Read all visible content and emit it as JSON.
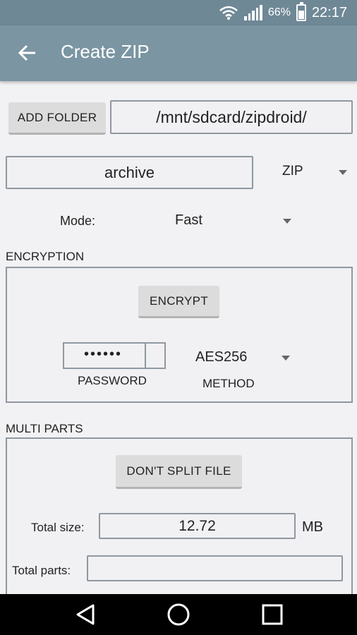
{
  "status_bar": {
    "battery_percent": "66%",
    "time": "22:17",
    "icons": [
      "wifi-icon",
      "signal-icon",
      "battery-icon"
    ]
  },
  "app_bar": {
    "title": "Create ZIP",
    "back_icon": "arrow-back-icon"
  },
  "destination": {
    "add_folder_label": "ADD FOLDER",
    "path": "/mnt/sdcard/zipdroid/"
  },
  "archive": {
    "name": "archive",
    "format": "ZIP"
  },
  "mode": {
    "label": "Mode:",
    "value": "Fast"
  },
  "encryption": {
    "section_title": "ENCRYPTION",
    "encrypt_label": "ENCRYPT",
    "password_mask": "••••••",
    "password_label": "PASSWORD",
    "method_value": "AES256",
    "method_label": "METHOD"
  },
  "multi_parts": {
    "section_title": "MULTI PARTS",
    "split_label": "DON'T SPLIT FILE",
    "total_size_label": "Total size:",
    "total_size_value": "12.72",
    "size_unit": "MB",
    "total_parts_label": "Total parts:",
    "total_parts_value": ""
  },
  "nav_bar": {
    "icons": [
      "nav-back-icon",
      "nav-home-icon",
      "nav-recent-icon"
    ]
  },
  "colors": {
    "app_bar": "#7b95a3",
    "status_bar": "#6f8896",
    "background": "#f2f1f3"
  }
}
